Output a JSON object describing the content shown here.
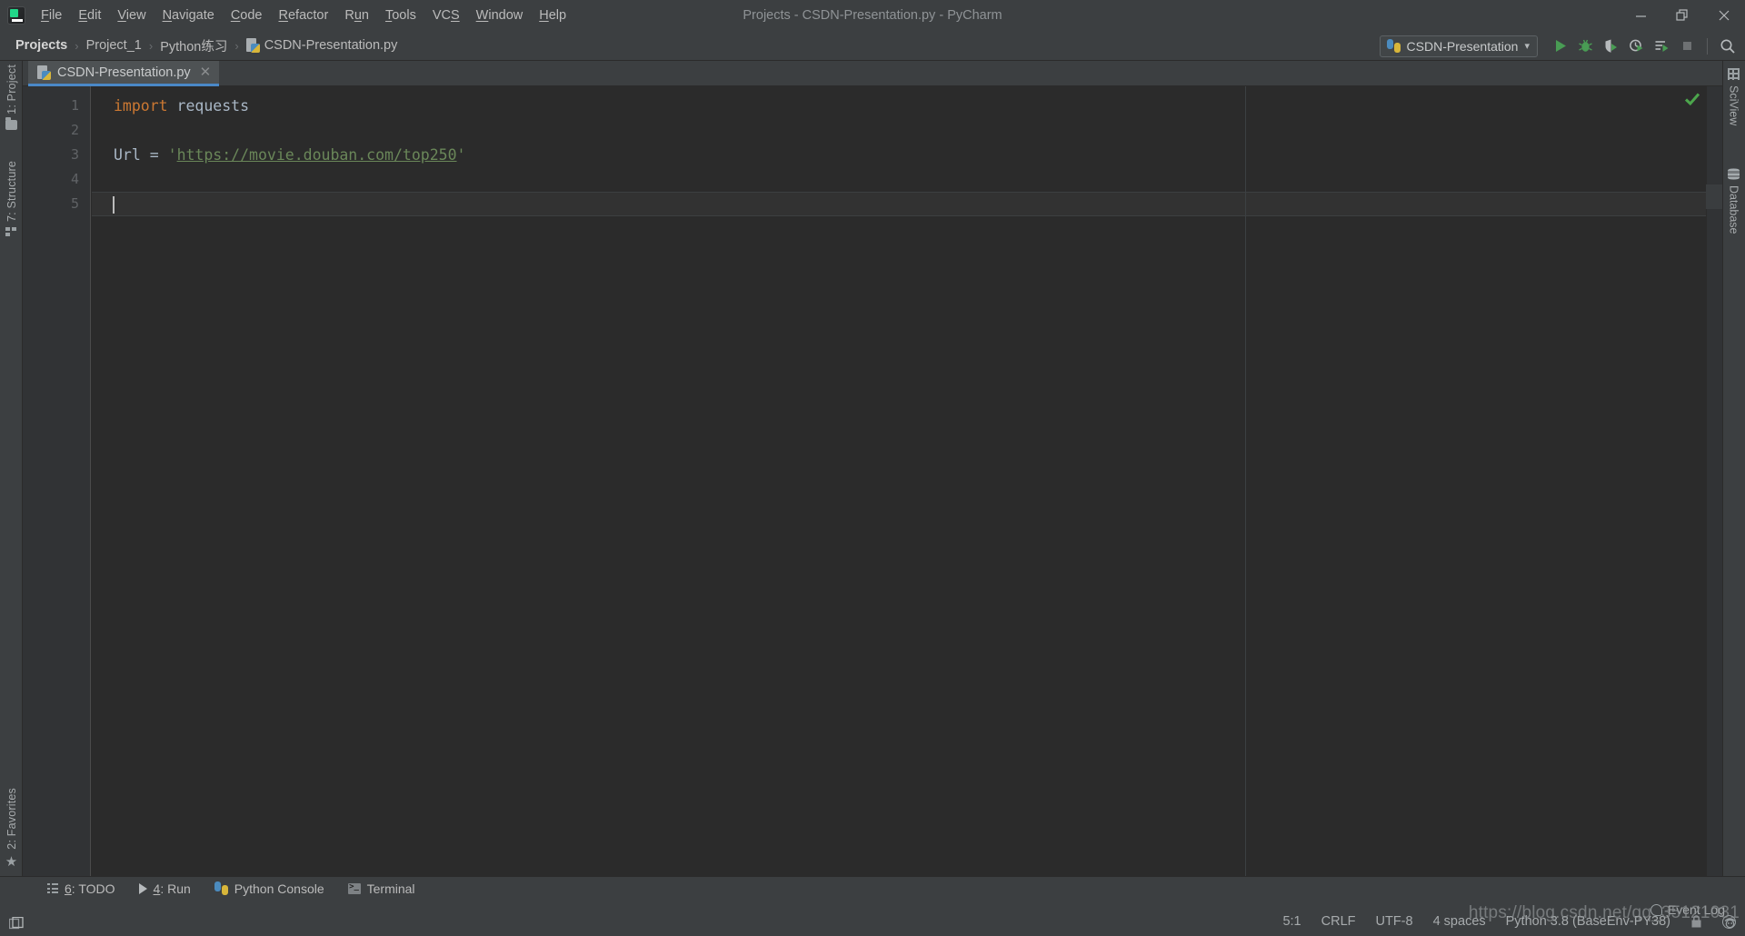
{
  "window": {
    "title": "Projects - CSDN-Presentation.py - PyCharm",
    "app_icon": "pycharm-logo-icon",
    "controls": {
      "minimize": "—",
      "restore": "❐",
      "close": "✕"
    }
  },
  "menu": {
    "items": [
      {
        "label": "File",
        "mnemonic": "F"
      },
      {
        "label": "Edit",
        "mnemonic": "E"
      },
      {
        "label": "View",
        "mnemonic": "V"
      },
      {
        "label": "Navigate",
        "mnemonic": "N"
      },
      {
        "label": "Code",
        "mnemonic": "C"
      },
      {
        "label": "Refactor",
        "mnemonic": "R"
      },
      {
        "label": "Run",
        "mnemonic": "u"
      },
      {
        "label": "Tools",
        "mnemonic": "T"
      },
      {
        "label": "VCS",
        "mnemonic": "S"
      },
      {
        "label": "Window",
        "mnemonic": "W"
      },
      {
        "label": "Help",
        "mnemonic": "H"
      }
    ]
  },
  "breadcrumb": {
    "separator": "›",
    "items": [
      {
        "label": "Projects",
        "icon": ""
      },
      {
        "label": "Project_1",
        "icon": ""
      },
      {
        "label": "Python练习",
        "icon": ""
      },
      {
        "label": "CSDN-Presentation.py",
        "icon": "python-file-icon"
      }
    ]
  },
  "toolbar": {
    "run_config": {
      "label": "CSDN-Presentation",
      "icon": "python-icon",
      "dropdown": "▾"
    },
    "buttons": [
      {
        "name": "run-button",
        "tooltip": "Run",
        "icon": "play-icon"
      },
      {
        "name": "debug-button",
        "tooltip": "Debug",
        "icon": "bug-icon"
      },
      {
        "name": "coverage-button",
        "tooltip": "Run with Coverage",
        "icon": "coverage-icon"
      },
      {
        "name": "profile-button",
        "tooltip": "Profile",
        "icon": "profiler-icon"
      },
      {
        "name": "run-output-button",
        "tooltip": "Run with Output",
        "icon": "run-list-icon"
      },
      {
        "name": "stop-button",
        "tooltip": "Stop",
        "icon": "stop-icon"
      },
      {
        "name": "search-everywhere",
        "tooltip": "Search Everywhere",
        "icon": "search-icon"
      }
    ]
  },
  "sidebar_left": {
    "tabs": [
      {
        "label": "1: Project",
        "mnemonic": "1",
        "icon": "folder-icon"
      },
      {
        "label": "7: Structure",
        "mnemonic": "7",
        "icon": "structure-icon"
      }
    ],
    "bottom": [
      {
        "label": "2: Favorites",
        "mnemonic": "2",
        "icon": "star-icon"
      }
    ]
  },
  "sidebar_right": {
    "tabs": [
      {
        "label": "SciView",
        "icon": "grid-icon"
      },
      {
        "label": "Database",
        "icon": "database-icon"
      }
    ]
  },
  "editor": {
    "tab": {
      "label": "CSDN-Presentation.py",
      "icon": "python-file-icon",
      "close": "✕",
      "active": true
    },
    "inspection_status": "ok",
    "inspection_icon": "green-check-icon",
    "margin_guide_column": 120,
    "lines": [
      {
        "num": "1",
        "tokens": [
          {
            "t": "import",
            "c": "kw"
          },
          {
            "t": " requests",
            "c": "var"
          }
        ],
        "current": false
      },
      {
        "num": "2",
        "tokens": [],
        "current": false
      },
      {
        "num": "3",
        "tokens": [
          {
            "t": "Url ",
            "c": "var"
          },
          {
            "t": "= ",
            "c": "op"
          },
          {
            "t": "'",
            "c": "str"
          },
          {
            "t": "https://movie.douban.com/top250",
            "c": "url"
          },
          {
            "t": "'",
            "c": "str"
          }
        ],
        "current": false
      },
      {
        "num": "4",
        "tokens": [],
        "current": false
      },
      {
        "num": "5",
        "tokens": [],
        "current": true,
        "caret": true
      }
    ]
  },
  "bottom_tools": [
    {
      "label": "6: TODO",
      "mnemonic": "6",
      "icon": "todo-list-icon"
    },
    {
      "label": "4: Run",
      "mnemonic": "4",
      "icon": "play-icon"
    },
    {
      "label": "Python Console",
      "mnemonic": "",
      "icon": "python-icon"
    },
    {
      "label": "Terminal",
      "mnemonic": "",
      "icon": "terminal-icon"
    }
  ],
  "event_log": {
    "label": "Event Log",
    "icon": "balloon-icon"
  },
  "status_bar": {
    "caret_position": "5:1",
    "line_separator": "CRLF",
    "encoding": "UTF-8",
    "indent": "4 spaces",
    "interpreter": "Python 3.8 (BaseEnv-PY38)",
    "lock_icon": "lock-icon",
    "face_icon": "hector-icon"
  },
  "watermark": {
    "text": "https://blog.csdn.net/qq_35121031"
  },
  "colors": {
    "chrome": "#3c3f41",
    "editor_bg": "#2b2b2b",
    "gutter_bg": "#313335",
    "current_line": "#323232",
    "tab_active_underline": "#4a88c7",
    "keyword": "#cc7832",
    "string": "#6a8759",
    "identifier": "#a9b7c6",
    "accent_green": "#499c54"
  }
}
